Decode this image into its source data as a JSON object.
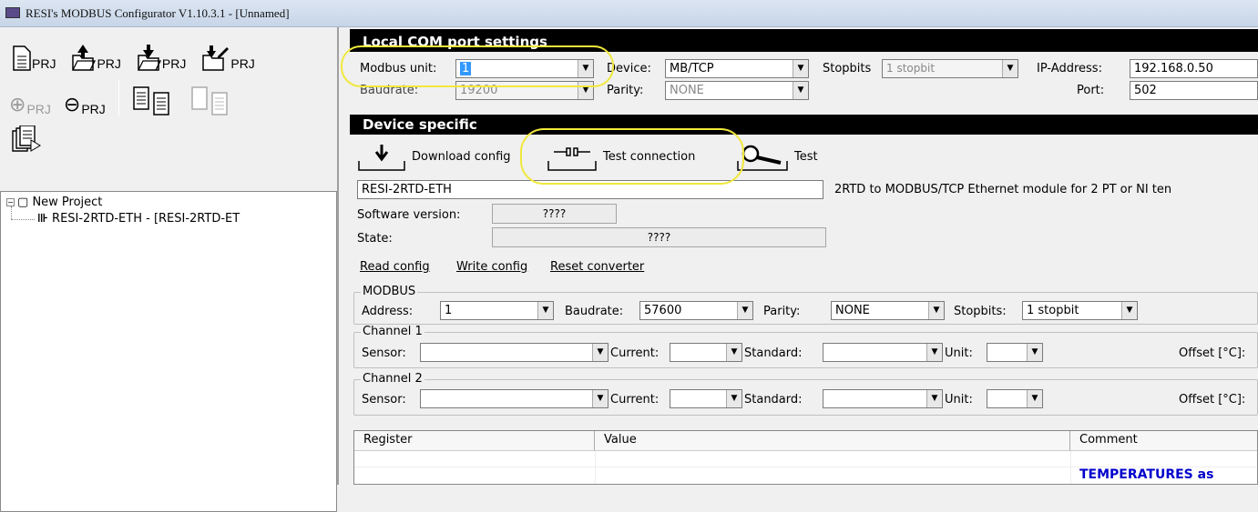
{
  "window": {
    "title": "RESI's MODBUS Configurator V1.10.3.1 - [Unnamed]"
  },
  "toolbar": {
    "row1": [
      {
        "icon": "new-project-icon",
        "label": "PRJ"
      },
      {
        "icon": "open-project-icon",
        "label": "PRJ"
      },
      {
        "icon": "save-project-icon",
        "label": "PRJ"
      },
      {
        "icon": "save-as-project-icon",
        "label": "PRJ"
      }
    ],
    "row2": [
      {
        "icon": "add-project-icon",
        "label": "PRJ"
      },
      {
        "icon": "remove-project-icon",
        "label": "PRJ"
      }
    ],
    "prj": "PRJ"
  },
  "tree": {
    "root": "New Project",
    "child": "RESI-2RTD-ETH - [RESI-2RTD-ET"
  },
  "local_com": {
    "header": "Local COM port settings",
    "modbus_unit_label": "Modbus unit:",
    "modbus_unit": "1",
    "baudrate_label": "Baudrate:",
    "baudrate": "19200",
    "device_label": "Device:",
    "device": "MB/TCP",
    "parity_label": "Parity:",
    "parity": "NONE",
    "stopbits_label": "Stopbits",
    "stopbits": "1 stopbit",
    "ip_label": "IP-Address:",
    "ip": "192.168.0.50",
    "port_label": "Port:",
    "port": "502"
  },
  "device": {
    "header": "Device specific",
    "download": "Download config",
    "test_connection": "Test connection",
    "test": "Test",
    "name": "RESI-2RTD-ETH",
    "description": "2RTD to MODBUS/TCP Ethernet module for 2 PT or NI ten",
    "sw_label": "Software version:",
    "sw": "????",
    "state_label": "State:",
    "state": "????",
    "read_config": "Read config",
    "write_config": "Write config",
    "reset_converter": "Reset converter"
  },
  "modbus": {
    "title": "MODBUS",
    "address_label": "Address:",
    "address": "1",
    "baudrate_label": "Baudrate:",
    "baudrate": "57600",
    "parity_label": "Parity:",
    "parity": "NONE",
    "stopbits_label": "Stopbits:",
    "stopbits": "1 stopbit"
  },
  "channel1": {
    "title": "Channel 1",
    "sensor": "Sensor:",
    "current": "Current:",
    "standard": "Standard:",
    "unit": "Unit:",
    "offset": "Offset [°C]:"
  },
  "channel2": {
    "title": "Channel 2",
    "sensor": "Sensor:",
    "current": "Current:",
    "standard": "Standard:",
    "unit": "Unit:",
    "offset": "Offset [°C]:"
  },
  "table": {
    "headers": [
      "Register",
      "Value",
      "Comment"
    ],
    "row_comment": "TEMPERATURES as"
  },
  "colors": {
    "highlight": "#f0e83c",
    "header_bg": "#000000",
    "selection": "#3399ff",
    "link_blue": "#0000cc"
  }
}
